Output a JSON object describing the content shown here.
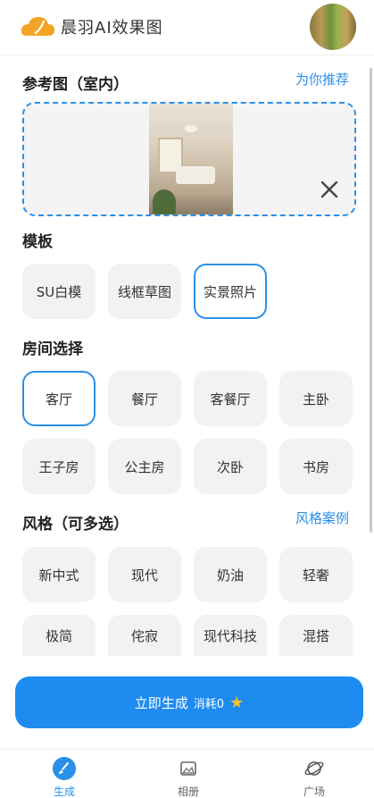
{
  "header": {
    "title": "晨羽AI效果图"
  },
  "reference": {
    "title": "参考图（室内）",
    "recommend_link": "为你推荐"
  },
  "template": {
    "title": "模板",
    "options": [
      "SU白模",
      "线框草图",
      "实景照片"
    ],
    "selected": "实景照片"
  },
  "room": {
    "title": "房间选择",
    "options": [
      "客厅",
      "餐厅",
      "客餐厅",
      "主卧",
      "王子房",
      "公主房",
      "次卧",
      "书房"
    ],
    "selected": "客厅"
  },
  "style": {
    "title": "风格（可多选）",
    "cases_link": "风格案例",
    "options": [
      "新中式",
      "现代",
      "奶油",
      "轻奢",
      "极简",
      "侘寂",
      "现代科技",
      "混搭"
    ]
  },
  "generate": {
    "label": "立即生成",
    "cost": "消耗0",
    "star_icon": "star-icon"
  },
  "tabs": [
    {
      "label": "生成",
      "icon": "brush-icon",
      "active": true
    },
    {
      "label": "相册",
      "icon": "album-icon",
      "active": false
    },
    {
      "label": "广场",
      "icon": "planet-icon",
      "active": false
    }
  ],
  "colors": {
    "accent": "#2a90e8",
    "button": "#1e8bf0"
  }
}
